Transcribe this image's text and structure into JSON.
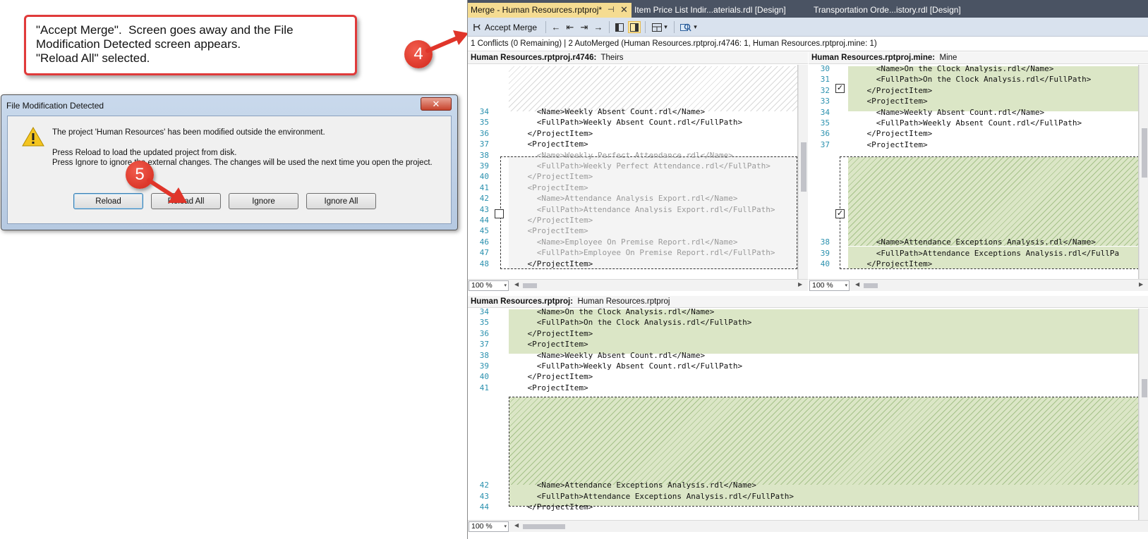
{
  "callout": {
    "line1": "\"Accept Merge\".  Screen goes away and the File",
    "line2": "Modification Detected screen appears.",
    "line3": "\"Reload All\" selected."
  },
  "badges": {
    "step4": "4",
    "step5": "5"
  },
  "dialog": {
    "title": "File Modification Detected",
    "close_glyph": "✕",
    "message1": "The project 'Human Resources' has been modified outside the environment.",
    "message2": "Press Reload to load the updated project from disk.",
    "message3": "Press Ignore to ignore the external changes. The changes will be used the next time you open the project.",
    "buttons": {
      "reload": "Reload",
      "reload_all": "Reload All",
      "ignore": "Ignore",
      "ignore_all": "Ignore All"
    }
  },
  "vs": {
    "tabs": {
      "active": "Merge - Human Resources.rptproj*",
      "pin_glyph": "⊣",
      "close_glyph": "✕",
      "tab2": "Item Price List Indir...aterials.rdl [Design]",
      "tab3": "Transportation Orde...istory.rdl [Design]"
    },
    "toolbar": {
      "accept_merge": "Accept Merge",
      "nav_icons": [
        "←",
        "⇤",
        "⇥",
        "→"
      ],
      "dropdown_glyph": "▾"
    },
    "status": "1 Conflicts (0 Remaining) | 2 AutoMerged (Human Resources.rptproj.r4746: 1, Human Resources.rptproj.mine: 1)",
    "theirs": {
      "title": "Human Resources.rptproj.r4746:",
      "subtitle": "Theirs",
      "lines": [
        {
          "n": "34",
          "t": "      <Name>Weekly Absent Count.rdl</Name>"
        },
        {
          "n": "35",
          "t": "      <FullPath>Weekly Absent Count.rdl</FullPath>"
        },
        {
          "n": "36",
          "t": "    </ProjectItem>"
        },
        {
          "n": "37",
          "t": "    <ProjectItem>"
        },
        {
          "n": "38",
          "t": "      <Name>Weekly Perfect Attendance.rdl</Name>"
        },
        {
          "n": "39",
          "t": "      <FullPath>Weekly Perfect Attendance.rdl</FullPath>"
        },
        {
          "n": "40",
          "t": "    </ProjectItem>"
        },
        {
          "n": "41",
          "t": "    <ProjectItem>"
        },
        {
          "n": "42",
          "t": "      <Name>Attendance Analysis Export.rdl</Name>"
        },
        {
          "n": "43",
          "t": "      <FullPath>Attendance Analysis Export.rdl</FullPath>"
        },
        {
          "n": "44",
          "t": "    </ProjectItem>"
        },
        {
          "n": "45",
          "t": "    <ProjectItem>"
        },
        {
          "n": "46",
          "t": "      <Name>Employee On Premise Report.rdl</Name>"
        },
        {
          "n": "47",
          "t": "      <FullPath>Employee On Premise Report.rdl</FullPath>"
        },
        {
          "n": "48",
          "t": "    </ProjectItem>"
        }
      ],
      "zoom": "100 %"
    },
    "mine": {
      "title": "Human Resources.rptproj.mine:",
      "subtitle": "Mine",
      "lines": [
        {
          "n": "30",
          "t": "      <Name>On the Clock Analysis.rdl</Name>"
        },
        {
          "n": "31",
          "t": "      <FullPath>On the Clock Analysis.rdl</FullPath>"
        },
        {
          "n": "32",
          "t": "    </ProjectItem>"
        },
        {
          "n": "33",
          "t": "    <ProjectItem>"
        },
        {
          "n": "34",
          "t": "      <Name>Weekly Absent Count.rdl</Name>"
        },
        {
          "n": "35",
          "t": "      <FullPath>Weekly Absent Count.rdl</FullPath>"
        },
        {
          "n": "36",
          "t": "    </ProjectItem>"
        },
        {
          "n": "37",
          "t": "    <ProjectItem>"
        },
        {
          "n": "38",
          "t": "      <Name>Attendance Exceptions Analysis.rdl</Name>"
        },
        {
          "n": "39",
          "t": "      <FullPath>Attendance Exceptions Analysis.rdl</FullPa"
        },
        {
          "n": "40",
          "t": "    </ProjectItem>"
        }
      ],
      "check_glyph": "✓",
      "zoom": "100 %"
    },
    "result": {
      "title": "Human Resources.rptproj:",
      "subtitle": "Human Resources.rptproj",
      "lines": [
        {
          "n": "34",
          "t": "      <Name>On the Clock Analysis.rdl</Name>"
        },
        {
          "n": "35",
          "t": "      <FullPath>On the Clock Analysis.rdl</FullPath>"
        },
        {
          "n": "36",
          "t": "    </ProjectItem>"
        },
        {
          "n": "37",
          "t": "    <ProjectItem>"
        },
        {
          "n": "38",
          "t": "      <Name>Weekly Absent Count.rdl</Name>"
        },
        {
          "n": "39",
          "t": "      <FullPath>Weekly Absent Count.rdl</FullPath>"
        },
        {
          "n": "40",
          "t": "    </ProjectItem>"
        },
        {
          "n": "41",
          "t": "    <ProjectItem>"
        },
        {
          "n": "42",
          "t": "      <Name>Attendance Exceptions Analysis.rdl</Name>"
        },
        {
          "n": "43",
          "t": "      <FullPath>Attendance Exceptions Analysis.rdl</FullPath>"
        },
        {
          "n": "44",
          "t": "    </ProjectItem>"
        }
      ],
      "zoom": "100 %"
    }
  }
}
